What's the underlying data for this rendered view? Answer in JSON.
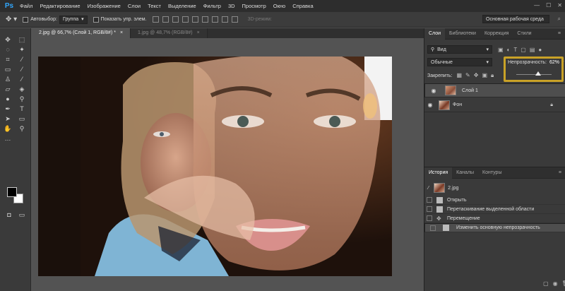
{
  "app": {
    "logo": "Ps"
  },
  "menu": [
    "Файл",
    "Редактирование",
    "Изображение",
    "Слои",
    "Текст",
    "Выделение",
    "Фильтр",
    "3D",
    "Просмотр",
    "Окно",
    "Справка"
  ],
  "window_buttons": [
    "—",
    "☐",
    "✕"
  ],
  "options": {
    "autoselect_label": "Автовыбор:",
    "autoselect_value": "Группа",
    "show_controls_label": "Показать упр. элем.",
    "mode3d_label": "3D-режим:",
    "workspace_value": "Основная рабочая среда"
  },
  "doc_tabs": [
    {
      "label": "2.jpg @ 66,7% (Слой 1, RGB/8#) *",
      "close": "×"
    },
    {
      "label": "1.jpg @ 48,7% (RGB/8#)",
      "close": "×"
    }
  ],
  "layers_panel": {
    "tabs": [
      "Слои",
      "Библиотеки",
      "Коррекция",
      "Стили"
    ],
    "filter_label": "Вид",
    "blend_mode": "Обычные",
    "opacity_label": "Непрозрачность:",
    "opacity_value": "62%",
    "opacity_fraction": 0.62,
    "lock_label": "Закрепить:",
    "fill_label": "Заливка:",
    "fill_value": "100%",
    "layers": [
      {
        "name": "Слой 1",
        "selected": true
      },
      {
        "name": "Фон",
        "selected": false,
        "locked": true
      }
    ]
  },
  "history_panel": {
    "tabs": [
      "История",
      "Каналы",
      "Контуры"
    ],
    "snapshot": "2.jpg",
    "items": [
      {
        "label": "Открыть",
        "selected": false
      },
      {
        "label": "Перетаскивание выделенной области",
        "selected": false
      },
      {
        "label": "Перемещение",
        "selected": false
      },
      {
        "label": "Изменить основную непрозрачность",
        "selected": true
      }
    ]
  },
  "colors": {
    "highlight": "#c9a227",
    "foreground": "#000000",
    "background": "#ffffff"
  }
}
